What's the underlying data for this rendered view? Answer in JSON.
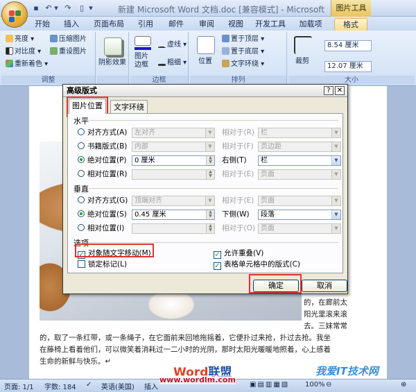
{
  "window": {
    "title": "新建 Microsoft Word 文档.doc [兼容模式] - Microsoft Word",
    "contextual_tab": "图片工具"
  },
  "tabs": [
    "开始",
    "插入",
    "页面布局",
    "引用",
    "邮件",
    "审阅",
    "视图",
    "开发工具",
    "加载项",
    "格式"
  ],
  "ribbon": {
    "adjust": {
      "brightness": "亮度",
      "contrast": "对比度",
      "recolor": "重新着色",
      "compress": "压缩图片",
      "reset": "重设图片",
      "label": "调整"
    },
    "shadow": {
      "effects": "阴影效果"
    },
    "border": {
      "picture_border": "图片\n边框",
      "dashes": "虚线",
      "weight": "粗细",
      "label": "边框"
    },
    "arrange": {
      "position": "位置",
      "bring_front": "置于顶层",
      "send_back": "置于底层",
      "text_wrap": "文字环绕",
      "label": "排列"
    },
    "size": {
      "crop": "裁剪",
      "height": "8.54 厘米",
      "width": "12.07 厘米",
      "label": "大小"
    }
  },
  "dialog": {
    "title": "高级版式",
    "help": "?",
    "close": "✕",
    "tabs": {
      "position": "图片位置",
      "wrapping": "文字环绕"
    },
    "horizontal": {
      "title": "水平",
      "alignment": {
        "label": "对齐方式(A)",
        "value": "左对齐",
        "rel_label": "相对于(R)",
        "rel_value": "栏"
      },
      "book_layout": {
        "label": "书籍版式(B)",
        "value": "内部",
        "rel_label": "相对于(F)",
        "rel_value": "页边距"
      },
      "absolute": {
        "label": "绝对位置(P)",
        "value": "0 厘米",
        "rel_label": "右侧(T)",
        "rel_value": "栏"
      },
      "relative": {
        "label": "相对位置(R)",
        "rel_label": "相对于(E)",
        "rel_value": "页面"
      }
    },
    "vertical": {
      "title": "垂直",
      "alignment": {
        "label": "对齐方式(G)",
        "value": "顶端对齐",
        "rel_label": "相对于(E)",
        "rel_value": "页面"
      },
      "absolute": {
        "label": "绝对位置(S)",
        "value": "0.45 厘米",
        "rel_label": "下侧(W)",
        "rel_value": "段落"
      },
      "relative": {
        "label": "相对位置(I)",
        "rel_label": "相对于(O)",
        "rel_value": "页面"
      }
    },
    "options": {
      "title": "选项",
      "move_with_text": "对象随文字移动(M)",
      "lock_anchor": "锁定标记(L)",
      "allow_overlap": "允许重叠(V)",
      "layout_in_cell": "表格单元格中的版式(C)"
    },
    "ok": "确定",
    "cancel": "取消"
  },
  "document": {
    "right_col": [
      "的，在廊前太",
      "阳光里滚来滚",
      "去。三妹常常"
    ],
    "lines": [
      "的，取了一条红带，或一条绳子，在它面前来回地拖摇着，它便扑过来抢，扑过去抢。我坐",
      "在藤椅上看着他们，可以微笑着消耗过一二小时的光阴，那时太阳光暖暖地照着，心上感着",
      "生命的新鲜与快乐。↵"
    ]
  },
  "status": {
    "page": "页面: 1/1",
    "words": "字数: 184",
    "language": "英语(美国)",
    "insert": "插入",
    "zoom": "100%"
  },
  "watermarks": {
    "logo": "Word",
    "logo_suffix": "联盟",
    "url": "www.wordlm.com",
    "site": "我爱IT技术网"
  }
}
